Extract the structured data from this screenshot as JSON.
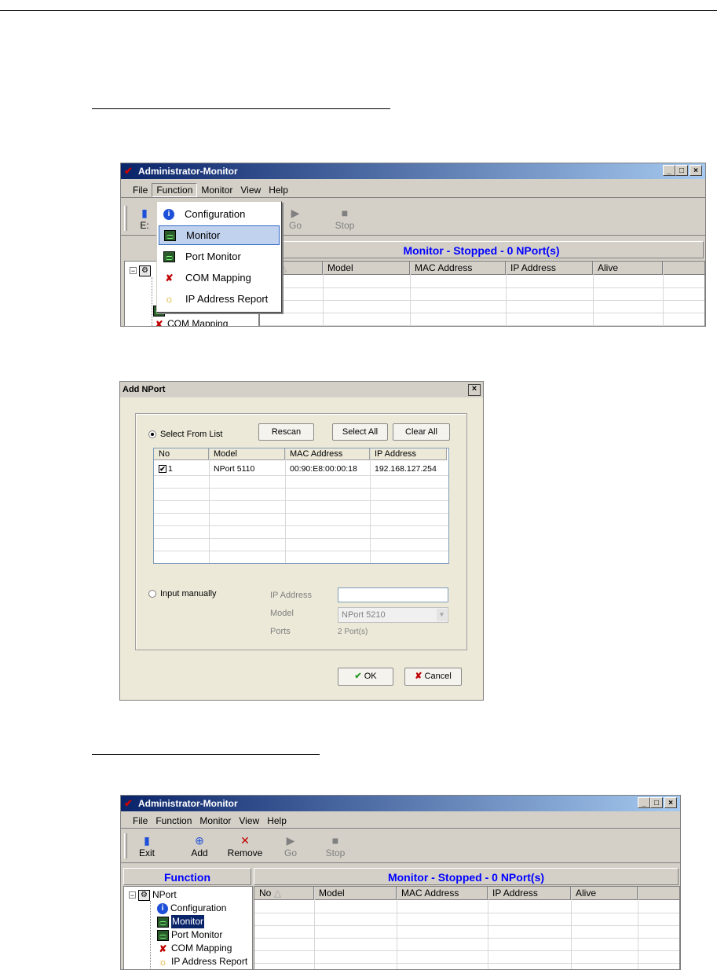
{
  "window1": {
    "title": "Administrator-Monitor",
    "caption_buttons": [
      "_",
      "□",
      "×"
    ],
    "menu": [
      "File",
      "Function",
      "Monitor",
      "View",
      "Help"
    ],
    "toolbar_partial": [
      "E:",
      "Go",
      "Stop"
    ],
    "pane_title": "Monitor - Stopped - 0 NPort(s)",
    "grid_headers": [
      "No",
      "Model",
      "MAC Address",
      "IP Address",
      "Alive"
    ],
    "dropdown": [
      {
        "label": "Configuration",
        "icon": "info-icon"
      },
      {
        "label": "Monitor",
        "icon": "monitor-icon"
      },
      {
        "label": "Port Monitor",
        "icon": "port-monitor-icon"
      },
      {
        "label": "COM Mapping",
        "icon": "com-mapping-icon"
      },
      {
        "label": "IP Address Report",
        "icon": "bulb-icon"
      }
    ],
    "tree_partial": [
      "Port Monitor",
      "COM Mapping"
    ]
  },
  "dialog": {
    "title": "Add NPort",
    "close": "×",
    "select_from_list": "Select From List",
    "rescan": "Rescan",
    "select_all": "Select All",
    "clear_all": "Clear All",
    "list_headers": [
      "No",
      "Model",
      "MAC Address",
      "IP Address"
    ],
    "rows": [
      {
        "no": "1",
        "model": "NPort 5110",
        "mac": "00:90:E8:00:00:18",
        "ip": "192.168.127.254",
        "checked": "✔"
      }
    ],
    "input_manually": "Input manually",
    "ip_label": "IP Address",
    "model_label": "Model",
    "model_value": "NPort 5210",
    "ports_label": "Ports",
    "ports_value": "2 Port(s)",
    "ok": "OK",
    "cancel": "Cancel"
  },
  "window2": {
    "title": "Administrator-Monitor",
    "caption_buttons": [
      "_",
      "□",
      "×"
    ],
    "menu": [
      "File",
      "Function",
      "Monitor",
      "View",
      "Help"
    ],
    "toolbar": [
      {
        "label": "Exit",
        "icon": "exit-icon",
        "enabled": true
      },
      {
        "label": "Add",
        "icon": "add-icon",
        "enabled": true
      },
      {
        "label": "Remove",
        "icon": "remove-icon",
        "enabled": true
      },
      {
        "label": "Go",
        "icon": "go-icon",
        "enabled": false
      },
      {
        "label": "Stop",
        "icon": "stop-icon",
        "enabled": false
      }
    ],
    "function_title": "Function",
    "pane_title": "Monitor - Stopped - 0 NPort(s)",
    "grid_headers": [
      "No",
      "Model",
      "MAC Address",
      "IP Address",
      "Alive"
    ],
    "tree": {
      "root": "NPort",
      "children": [
        "Configuration",
        "Monitor",
        "Port Monitor",
        "COM Mapping",
        "IP Address Report"
      ]
    }
  },
  "colors": {
    "accent": "#0000ff",
    "title_start": "#0a246a",
    "selection": "#0a246a"
  }
}
